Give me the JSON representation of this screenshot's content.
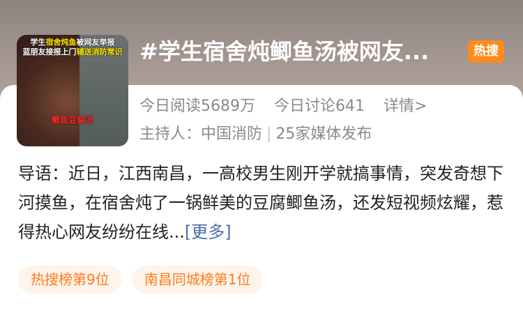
{
  "header": {
    "title": "#学生宿舍炖鲫鱼汤被网友...",
    "badge": "热搜"
  },
  "thumbnail": {
    "caption_line1_a": "学生",
    "caption_line1_hl": "宿舍炖鱼",
    "caption_line1_b": "被网友举报",
    "caption_line2_a": "蓝朋友接报上门",
    "caption_line2_hl": "辅送消防常识",
    "subtitle": "鲫鱼豆腐汤"
  },
  "stats": {
    "read": "今日阅读5689万",
    "discuss": "今日讨论641",
    "details": "详情>"
  },
  "host": {
    "label": "主持人：中国消防",
    "separator": "|",
    "media": "25家媒体发布"
  },
  "intro": {
    "text": "导语：近日，江西南昌，一高校男生刚开学就搞事情，突发奇想下河摸鱼，在宿舍炖了一锅鲜美的豆腐鲫鱼汤，还发短视频炫耀，惹得热心网友纷纷在线...",
    "more": "[更多]"
  },
  "tags": [
    "热搜榜第9位",
    "南昌同城榜第1位"
  ],
  "colors": {
    "accent_orange": "#ff8a1c",
    "link_blue": "#4a6fa5",
    "meta_gray": "#8a8a8a"
  }
}
